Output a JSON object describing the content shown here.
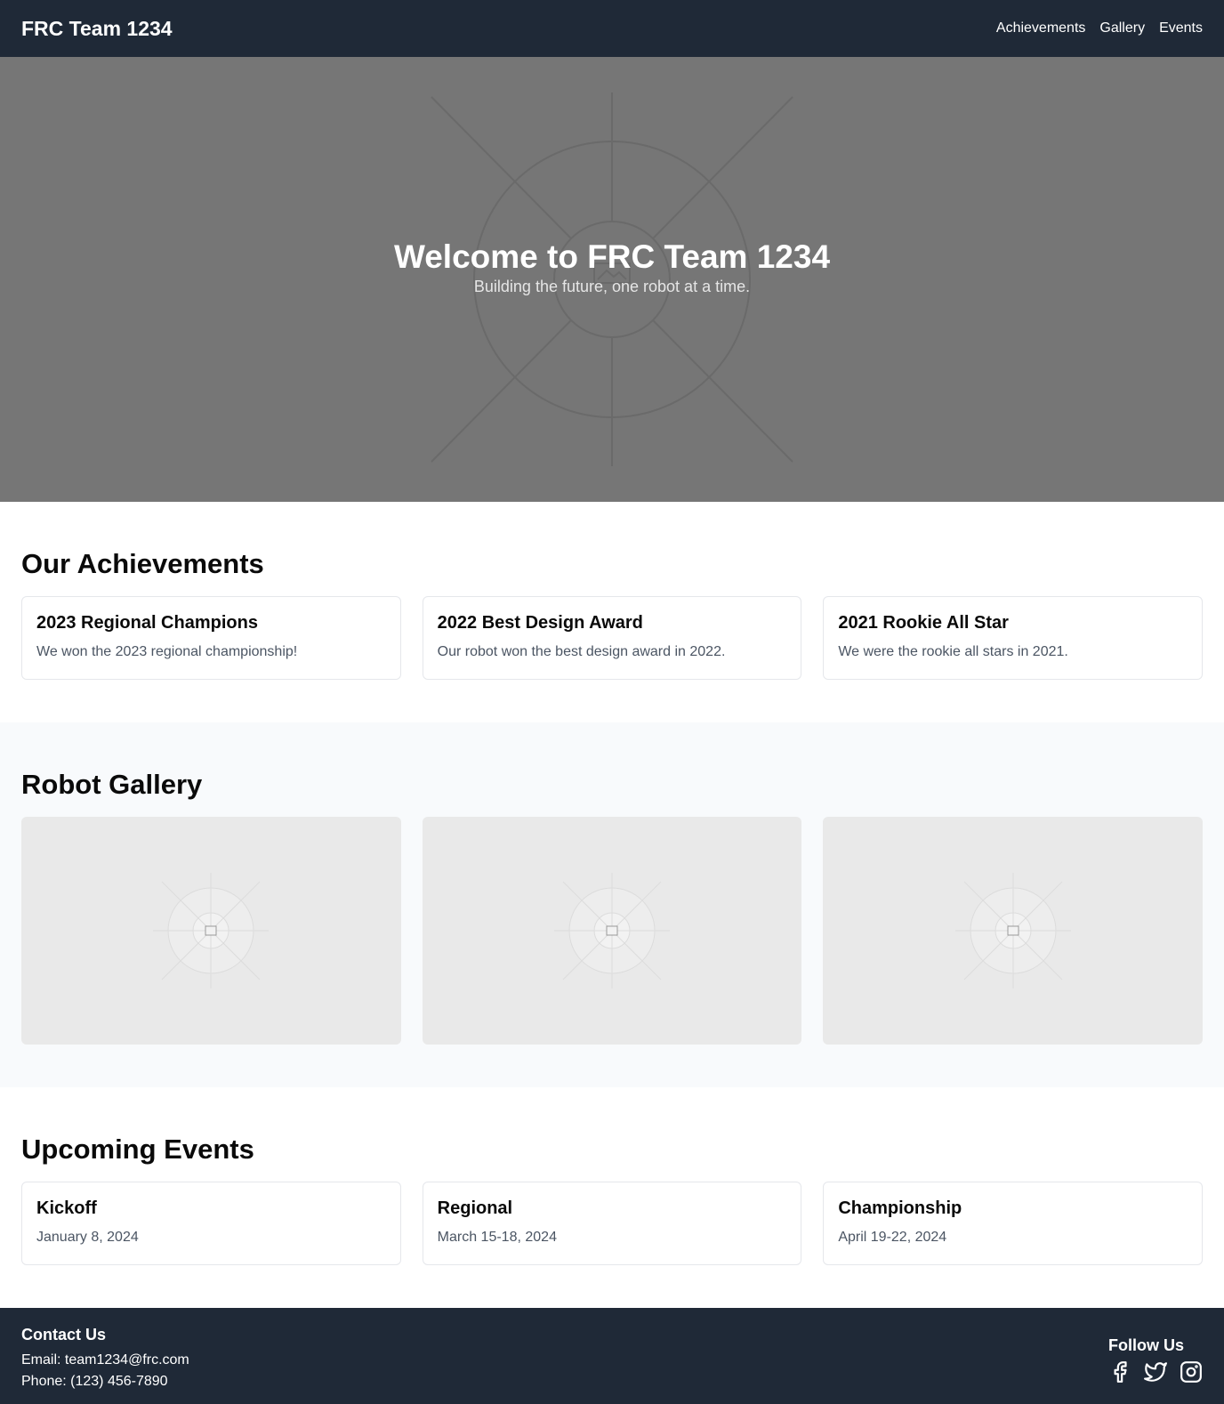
{
  "nav": {
    "brand": "FRC Team 1234",
    "links": [
      "Achievements",
      "Gallery",
      "Events"
    ]
  },
  "hero": {
    "title": "Welcome to FRC Team 1234",
    "subtitle": "Building the future, one robot at a time."
  },
  "achievements": {
    "heading": "Our Achievements",
    "items": [
      {
        "title": "2023 Regional Champions",
        "text": "We won the 2023 regional championship!"
      },
      {
        "title": "2022 Best Design Award",
        "text": "Our robot won the best design award in 2022."
      },
      {
        "title": "2021 Rookie All Star",
        "text": "We were the rookie all stars in 2021."
      }
    ]
  },
  "gallery": {
    "heading": "Robot Gallery",
    "images": [
      "image-placeholder",
      "image-placeholder",
      "image-placeholder"
    ]
  },
  "events": {
    "heading": "Upcoming Events",
    "items": [
      {
        "title": "Kickoff",
        "date": "January 8, 2024"
      },
      {
        "title": "Regional",
        "date": "March 15-18, 2024"
      },
      {
        "title": "Championship",
        "date": "April 19-22, 2024"
      }
    ]
  },
  "footer": {
    "contact_heading": "Contact Us",
    "email": "Email: team1234@frc.com",
    "phone": "Phone: (123) 456-7890",
    "follow_heading": "Follow Us",
    "social": [
      "facebook-icon",
      "twitter-icon",
      "instagram-icon"
    ]
  }
}
